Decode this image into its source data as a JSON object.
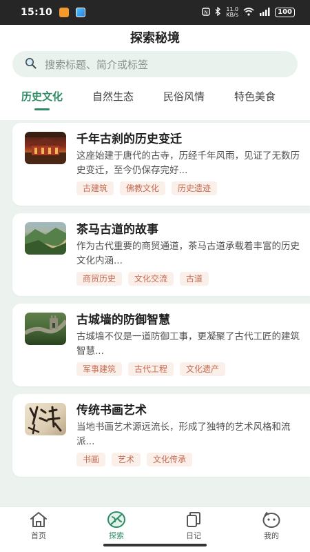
{
  "status_bar": {
    "time": "15:10",
    "network_speed": "11.0\nKB/s",
    "battery": "100"
  },
  "header": {
    "title": "探索秘境"
  },
  "search": {
    "placeholder": "搜索标题、简介或标签"
  },
  "tabs": [
    {
      "label": "历史文化",
      "active": true
    },
    {
      "label": "自然生态",
      "active": false
    },
    {
      "label": "民俗风情",
      "active": false
    },
    {
      "label": "特色美食",
      "active": false
    }
  ],
  "articles": [
    {
      "title": "千年古刹的历史变迁",
      "description": "这座始建于唐代的古寺，历经千年风雨，见证了无数历史变迁，至今仍保存完好...",
      "tags": [
        "古建筑",
        "佛教文化",
        "历史遗迹"
      ]
    },
    {
      "title": "茶马古道的故事",
      "description": "作为古代重要的商贸通道，茶马古道承载着丰富的历史文化内涵...",
      "tags": [
        "商贸历史",
        "文化交流",
        "古道"
      ]
    },
    {
      "title": "古城墙的防御智慧",
      "description": "古城墙不仅是一道防御工事，更凝聚了古代工匠的建筑智慧...",
      "tags": [
        "军事建筑",
        "古代工程",
        "文化遗产"
      ]
    },
    {
      "title": "传统书画艺术",
      "description": "当地书画艺术源远流长，形成了独特的艺术风格和流派...",
      "tags": [
        "书画",
        "艺术",
        "文化传承"
      ]
    }
  ],
  "bottom_nav": [
    {
      "label": "首页",
      "icon": "home-icon",
      "active": false
    },
    {
      "label": "探索",
      "icon": "explore-icon",
      "active": true
    },
    {
      "label": "日记",
      "icon": "diary-icon",
      "active": false
    },
    {
      "label": "我的",
      "icon": "profile-icon",
      "active": false
    }
  ],
  "colors": {
    "accent": "#2e8b64",
    "tag_text": "#c46a52",
    "tag_bg": "#fbefe9",
    "background": "#ecf3ef"
  }
}
